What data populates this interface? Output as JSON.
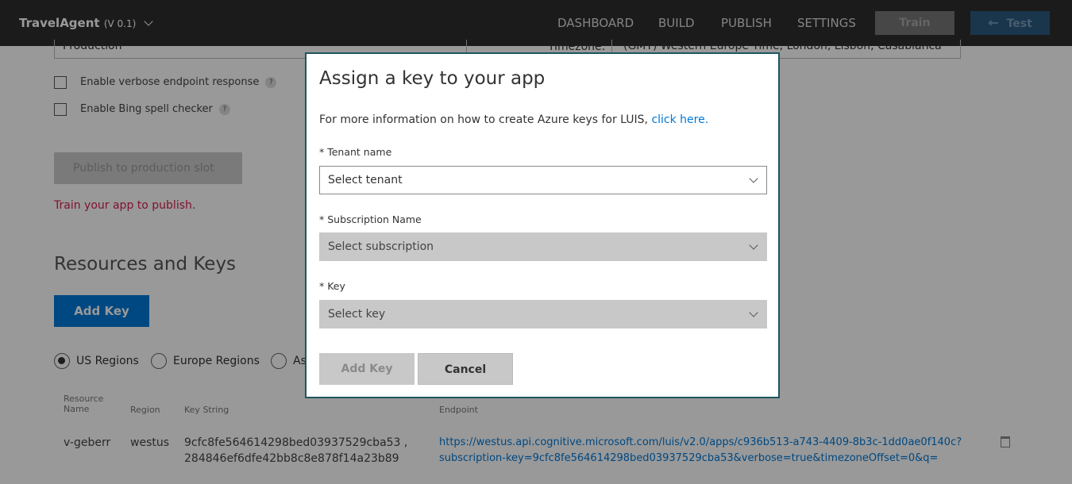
{
  "header": {
    "app_name": "TravelAgent",
    "version": "(V 0.1)",
    "nav": [
      "DASHBOARD",
      "BUILD",
      "PUBLISH",
      "SETTINGS"
    ],
    "train_label": "Train",
    "test_label": "Test"
  },
  "publish": {
    "slot_value": "Production",
    "timezone_label": "Timezone:",
    "timezone_value": "(GMT) Western Europe Time, London, Lisbon, Casablanca",
    "verbose_label": "Enable verbose endpoint response",
    "bing_label": "Enable Bing spell checker",
    "help_glyph": "?",
    "publish_button": "Publish to production slot",
    "warning": "Train your app to publish."
  },
  "resources": {
    "title": "Resources and Keys",
    "add_key_label": "Add Key",
    "regions": [
      "US Regions",
      "Europe Regions",
      "Asia Regions"
    ],
    "columns": [
      "Resource Name",
      "Region",
      "Key String",
      "Endpoint"
    ],
    "rows": [
      {
        "resource": "v-geberr",
        "region": "westus",
        "key_line1": "9cfc8fe564614298bed03937529cba53 ,",
        "key_line2": "284846ef6dfe42bb8c8e878f14a23b89",
        "endpoint_line1": "https://westus.api.cognitive.microsoft.com/luis/v2.0/apps/c936b513-a743-4409-8b3c-1dd0ae0f140c?",
        "endpoint_line2": "subscription-key=9cfc8fe564614298bed03937529cba53&verbose=true&timezoneOffset=0&q="
      }
    ]
  },
  "dialog": {
    "title": "Assign a key to your app",
    "info_text": "For more information on how to create Azure keys for LUIS, ",
    "info_link": "click here.",
    "tenant_label": "* Tenant name",
    "tenant_value": "Select tenant",
    "subscription_label": "* Subscription Name",
    "subscription_value": "Select subscription",
    "key_label": "* Key",
    "key_value": "Select key",
    "add_key_label": "Add Key",
    "cancel_label": "Cancel"
  },
  "colors": {
    "accent": "#0078d7",
    "warning": "#d6204f",
    "nav_bg": "#2e2e2e",
    "dialog_border": "#1e5560"
  }
}
